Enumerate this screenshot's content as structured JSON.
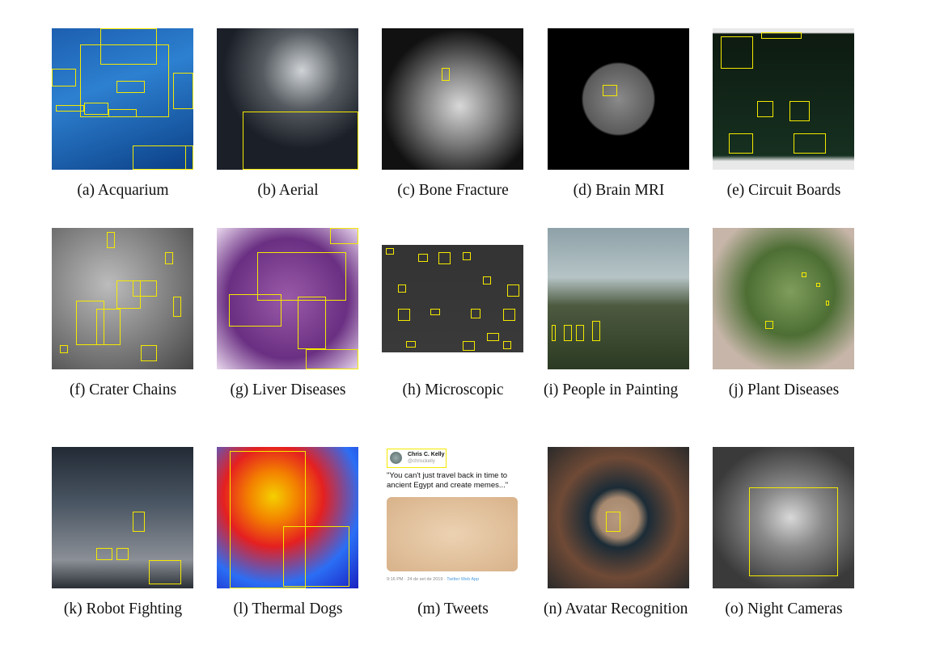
{
  "figure": {
    "panels": [
      {
        "caption": "(a) Acquarium",
        "scene": "underwater aquarium with fish"
      },
      {
        "caption": "(b) Aerial",
        "scene": "aerial satellite clouds"
      },
      {
        "caption": "(c) Bone Fracture",
        "scene": "x-ray ankle"
      },
      {
        "caption": "(d) Brain MRI",
        "scene": "brain mri scan"
      },
      {
        "caption": "(e) Circuit Boards",
        "scene": "circuit board"
      },
      {
        "caption": "(f) Crater Chains",
        "scene": "lunar surface"
      },
      {
        "caption": "(g) Liver Diseases",
        "scene": "histology slide"
      },
      {
        "caption": "(h) Microscopic",
        "scene": "microscopic cells"
      },
      {
        "caption": "(i) People in Paint­ing",
        "scene": "landscape painting"
      },
      {
        "caption": "(j) Plant Diseases",
        "scene": "leaf"
      },
      {
        "caption": "(k) Robot Fighting",
        "scene": "robot arena"
      },
      {
        "caption": "(l) Thermal Dogs",
        "scene": "thermal image of man and dog"
      },
      {
        "caption": "(m) Tweets",
        "scene": "tweet screenshot"
      },
      {
        "caption": "(n) Avatar Recogni­tion",
        "scene": "game scope view"
      },
      {
        "caption": "(o) Night Cameras",
        "scene": "night camera cheetah"
      }
    ],
    "tweet": {
      "name": "Chris C. Kelly",
      "handle": "@chrisckelly",
      "text": "\"You can't just travel back in time to ancient Egypt and create memes...\"",
      "time": "9:16 PM · 24 de set de 2019 · ",
      "source": "Twitter Web App"
    },
    "box_color": "#f5e900"
  }
}
